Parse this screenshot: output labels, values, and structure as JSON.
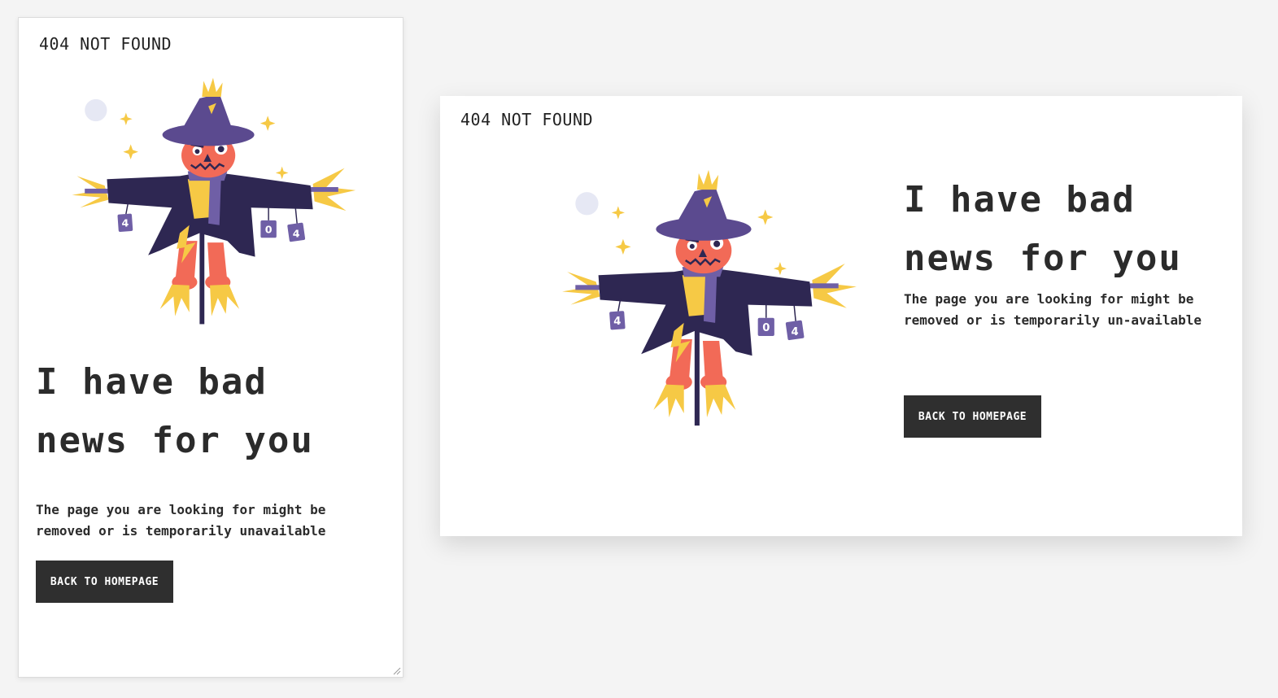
{
  "mobile": {
    "brand": "404 NOT FOUND",
    "title_line1": "I have bad",
    "title_line2": "news for you",
    "description": "The page you are looking for might be removed or is temporarily unavailable",
    "button_label": "BACK TO HOMEPAGE"
  },
  "desktop": {
    "brand": "404 NOT FOUND",
    "title_line1": "I have bad",
    "title_line2": "news for you",
    "description": "The page you are looking for might be removed or is temporarily un-available",
    "button_label": "BACK TO HOMEPAGE"
  },
  "illustration": {
    "can_labels": [
      "4",
      "0",
      "4"
    ],
    "colors": {
      "hat": "#5b4a8f",
      "coat": "#2e2752",
      "face": "#f26a57",
      "straw": "#f6c945",
      "scarf": "#6f5fa6",
      "moon": "#e6e8f4"
    }
  },
  "colors": {
    "background": "#f4f4f4",
    "card": "#ffffff",
    "text": "#2b2b2b",
    "button": "#2f2f2f",
    "button_text": "#ffffff"
  }
}
